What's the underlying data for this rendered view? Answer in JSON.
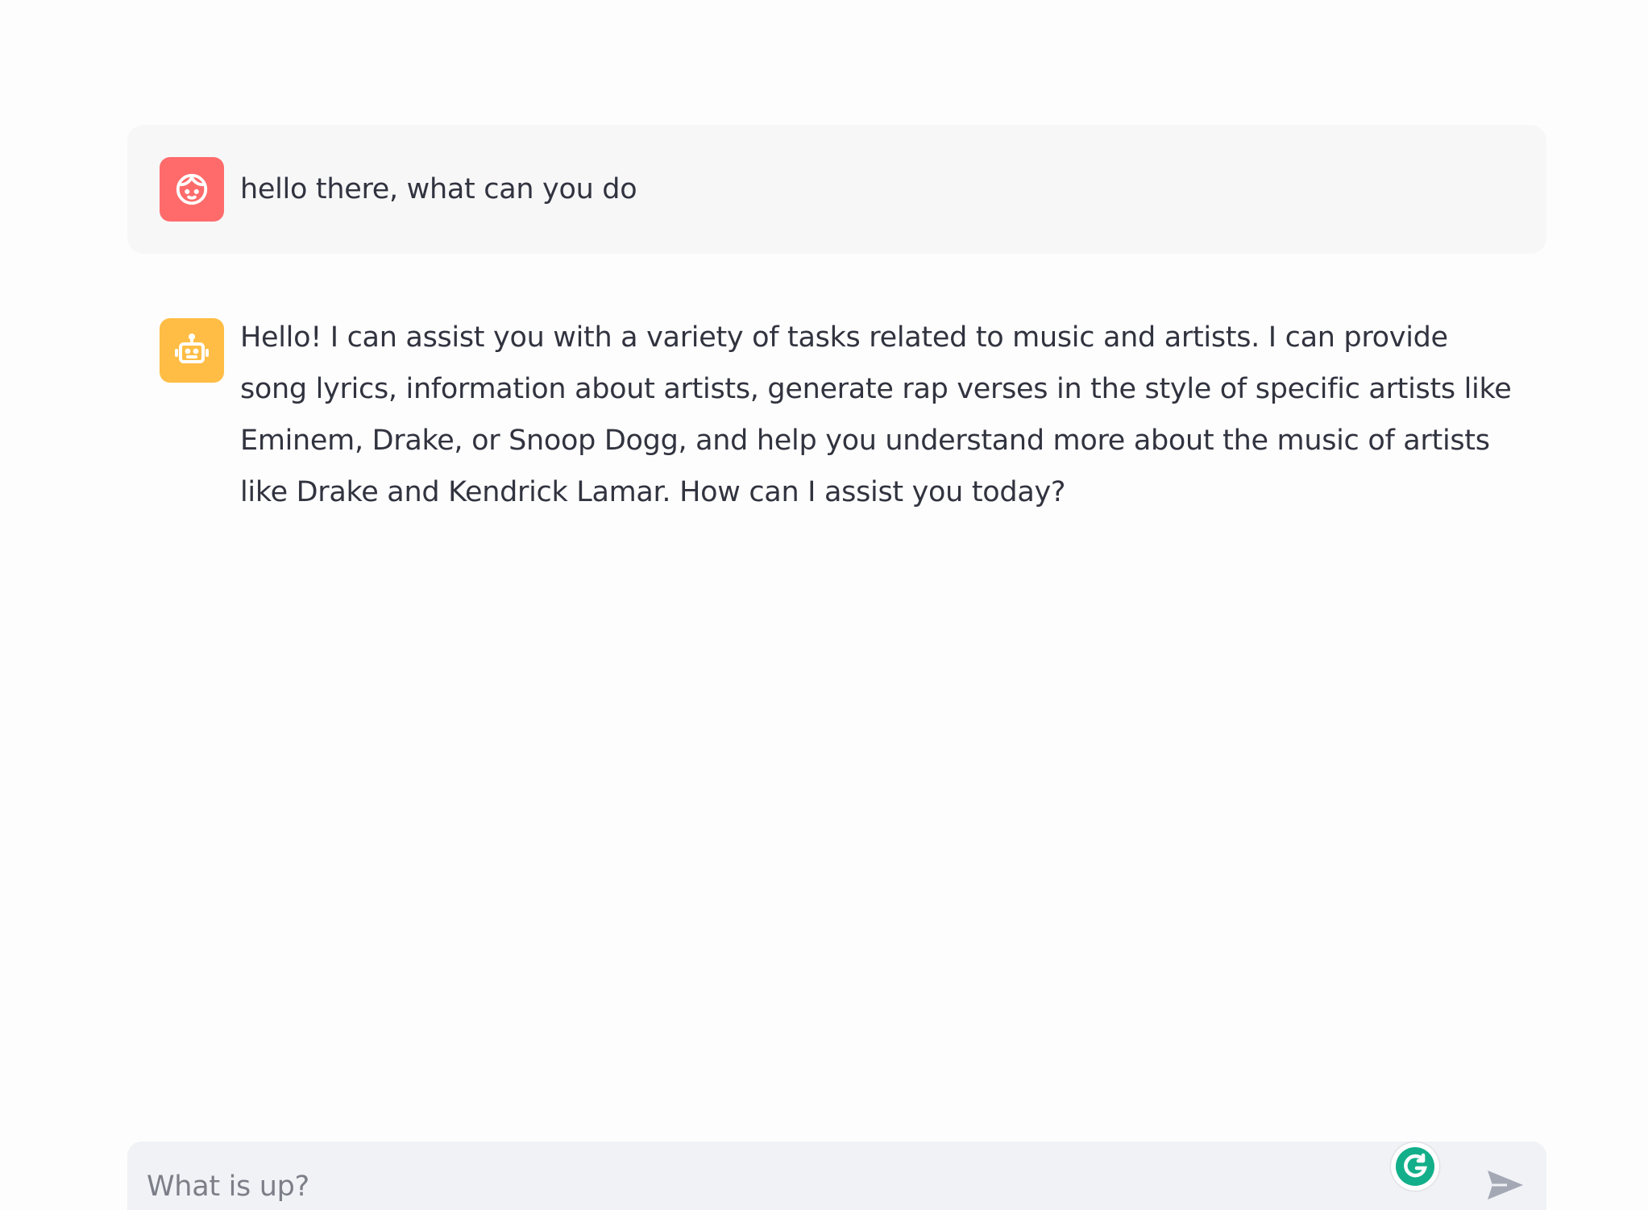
{
  "messages": [
    {
      "role": "user",
      "avatar_icon": "user-face-icon",
      "avatar_color": "#ff6b6b",
      "text": "hello there, what can you do"
    },
    {
      "role": "assistant",
      "avatar_icon": "robot-icon",
      "avatar_color": "#ffbd45",
      "text": "Hello! I can assist you with a variety of tasks related to music and artists. I can provide song lyrics, information about artists, generate rap verses in the style of specific artists like Eminem, Drake, or Snoop Dogg, and help you understand more about the music of artists like Drake and Kendrick Lamar. How can I assist you today?"
    }
  ],
  "chat_input": {
    "placeholder": "What is up?",
    "value": ""
  },
  "icons": {
    "grammarly": "grammarly-icon",
    "send": "send-icon"
  },
  "colors": {
    "user_bubble": "#f7f7f8",
    "input_bg": "#f0f2f6",
    "grammarly_green": "#15c39a",
    "send_gray": "#a3a8b4"
  }
}
